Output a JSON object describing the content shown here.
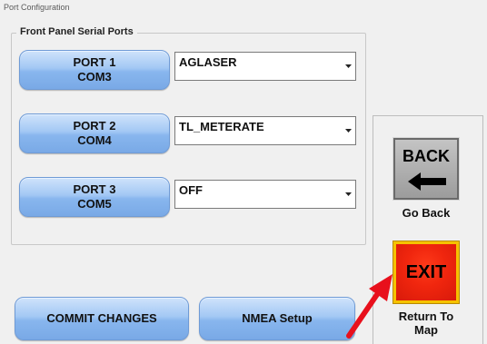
{
  "window": {
    "title": "Port Configuration"
  },
  "group": {
    "legend": "Front Panel Serial Ports"
  },
  "ports": [
    {
      "name": "PORT 1",
      "com": "COM3",
      "selected": "AGLASER"
    },
    {
      "name": "PORT 2",
      "com": "COM4",
      "selected": "TL_METERATE"
    },
    {
      "name": "PORT 3",
      "com": "COM5",
      "selected": "OFF"
    }
  ],
  "actions": {
    "commit_label": "COMMIT CHANGES",
    "nmea_label": "NMEA Setup"
  },
  "nav": {
    "back_label": "BACK",
    "back_caption": "Go Back",
    "exit_label": "EXIT",
    "exit_caption_line1": "Return To",
    "exit_caption_line2": "Map"
  },
  "icons": {
    "dropdown": "chevron-down-icon",
    "back_arrow": "arrow-left-icon",
    "annotation": "red-arrow-icon"
  },
  "colors": {
    "button_blue": "#88b6ee",
    "back_gray": "#b0b0b0",
    "exit_red": "#f0260e",
    "exit_border": "#f6c200",
    "annotation_arrow": "#e8101c"
  }
}
